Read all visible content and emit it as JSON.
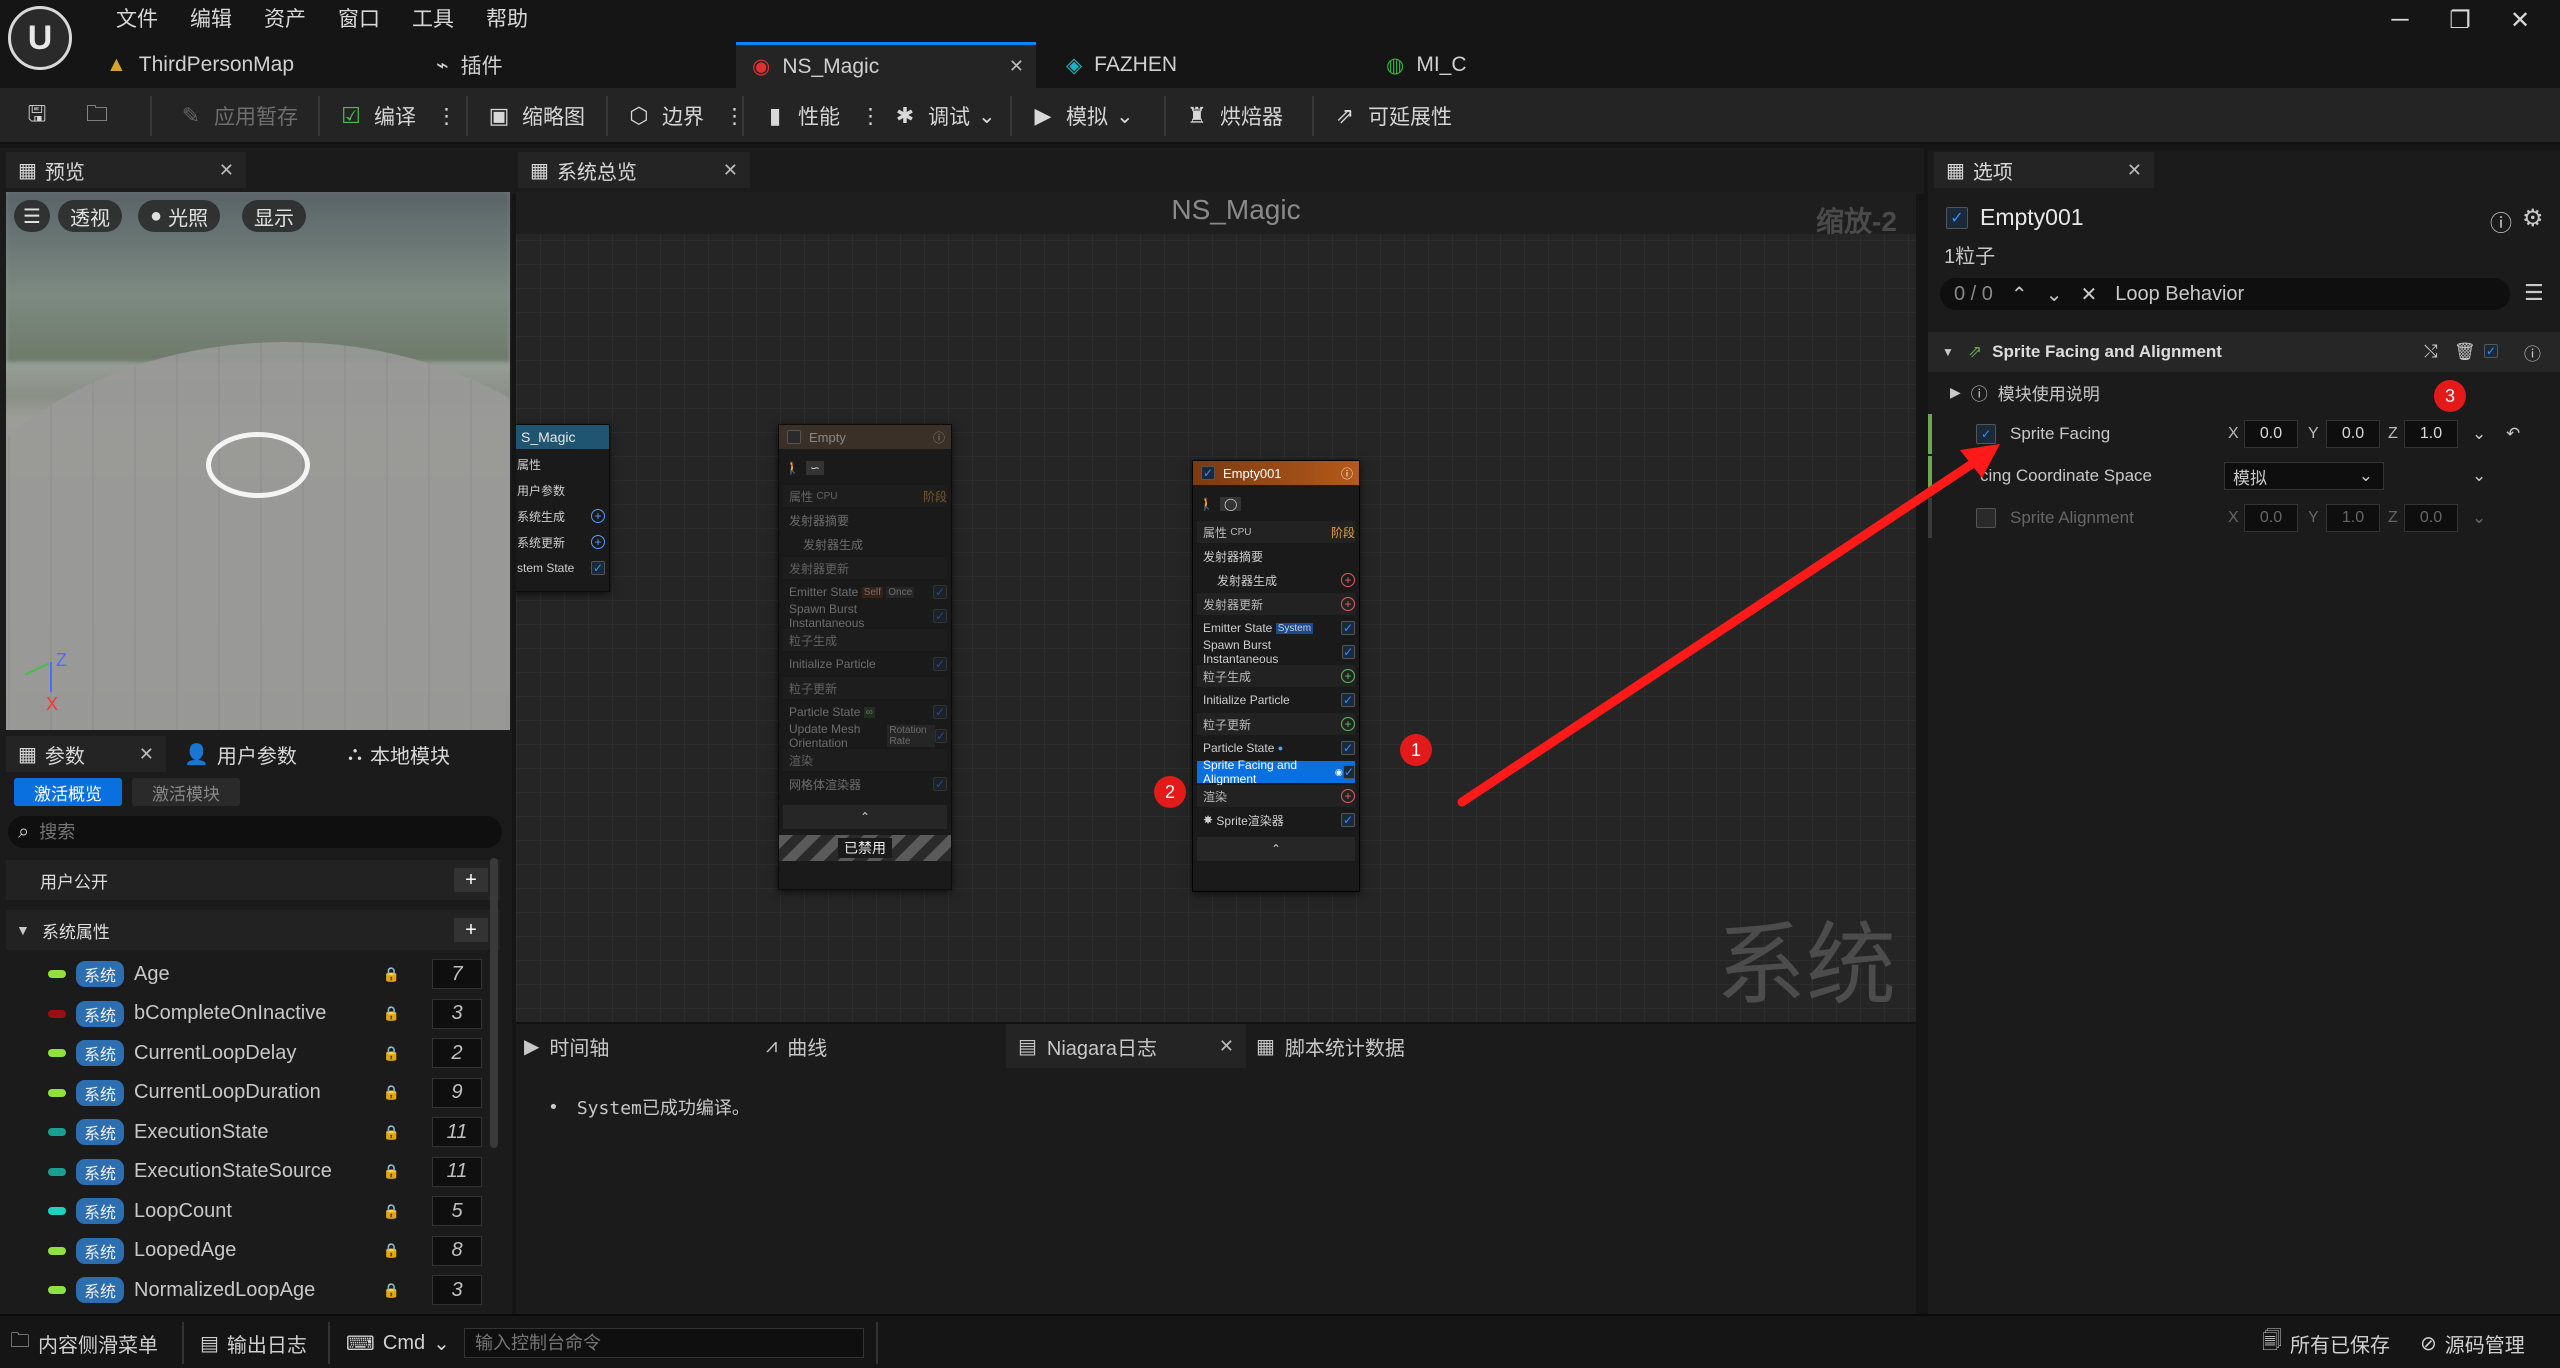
{
  "menu": [
    "文件",
    "编辑",
    "资产",
    "窗口",
    "工具",
    "帮助"
  ],
  "tabs": [
    {
      "label": "ThirdPersonMap",
      "icon": "map-icon"
    },
    {
      "label": "插件",
      "icon": "plug-icon"
    },
    {
      "label": "NS_Magic",
      "icon": "niagara-system-icon",
      "active": true
    },
    {
      "label": "FAZHEN",
      "icon": "emitter-icon"
    },
    {
      "label": "MI_C",
      "icon": "material-instance-icon"
    }
  ],
  "toolbar": {
    "apply": "应用暂存",
    "compile": "编译",
    "thumbnail": "缩略图",
    "bounds": "边界",
    "performance": "性能",
    "debug": "调试",
    "simulate": "模拟",
    "baker": "烘焙器",
    "scalability": "可延展性"
  },
  "preview": {
    "tab": "预览",
    "btn_perspective": "透视",
    "btn_lit": "光照",
    "btn_show": "显示",
    "axis_z": "Z",
    "axis_x": "X"
  },
  "params": {
    "tabs": [
      "参数",
      "用户参数",
      "本地模块"
    ],
    "sub_tabs": [
      "激活概览",
      "激活模块"
    ],
    "search_placeholder": "搜索",
    "user_exposed": "用户公开",
    "system_attrs": "系统属性",
    "badge": "系统",
    "rows": [
      {
        "name": "Age",
        "count": "7",
        "color": "#8fe040"
      },
      {
        "name": "bCompleteOnInactive",
        "count": "3",
        "color": "#9a1010"
      },
      {
        "name": "CurrentLoopDelay",
        "count": "2",
        "color": "#8fe040"
      },
      {
        "name": "CurrentLoopDuration",
        "count": "9",
        "color": "#8fe040"
      },
      {
        "name": "ExecutionState",
        "count": "11",
        "color": "#1aa090"
      },
      {
        "name": "ExecutionStateSource",
        "count": "11",
        "color": "#1aa090"
      },
      {
        "name": "LoopCount",
        "count": "5",
        "color": "#20d0c0"
      },
      {
        "name": "LoopedAge",
        "count": "8",
        "color": "#8fe040"
      },
      {
        "name": "NormalizedLoopAge",
        "count": "3",
        "color": "#8fe040"
      }
    ]
  },
  "overview": {
    "tab": "系统总览",
    "title": "NS_Magic",
    "zoom": "缩放-2",
    "watermark": "系统",
    "system_node": {
      "title": "S_Magic",
      "rows": [
        "属性",
        "用户参数",
        "系统生成",
        "系统更新",
        "stem State"
      ]
    },
    "empty_node": {
      "title": "Empty",
      "attr": "属性",
      "cpu": "CPU",
      "stage": "阶段",
      "rows": [
        "发射器摘要",
        "发射器生成",
        "发射器更新",
        "Emitter State",
        "Spawn Burst Instantaneous",
        "粒子生成",
        "Initialize Particle",
        "粒子更新",
        "Particle State",
        "Update Mesh Orientation",
        "渲染",
        "网格体渲染器"
      ],
      "tag_self": "Self",
      "tag_once": "Once",
      "tag_rotation": "Rotation Rate",
      "tag_dd": "∞",
      "disabled": "已禁用"
    },
    "empty001_node": {
      "title": "Empty001",
      "attr": "属性",
      "cpu": "CPU",
      "stage": "阶段",
      "rows": [
        "发射器摘要",
        "发射器生成",
        "发射器更新",
        "Emitter State",
        "Spawn Burst Instantaneous",
        "粒子生成",
        "Initialize Particle",
        "粒子更新",
        "Particle State",
        "Sprite Facing and Alignment",
        "渲染",
        "Sprite渲染器"
      ],
      "tag_system": "System"
    }
  },
  "log": {
    "tabs": [
      "时间轴",
      "曲线",
      "Niagara日志",
      "脚本统计数据"
    ],
    "message": "System已成功编译。"
  },
  "options": {
    "tab": "选项",
    "emitter": "Empty001",
    "particle_count": "1粒子",
    "search_count": "0 / 0",
    "search_value": "Loop Behavior",
    "module": "Sprite Facing and Alignment",
    "usage": "模块使用说明",
    "sprite_facing": {
      "label": "Sprite Facing",
      "x": "0.0",
      "y": "0.0",
      "z": "1.0"
    },
    "coord_space": {
      "label": "cing Coordinate Space",
      "value": "模拟"
    },
    "sprite_alignment": {
      "label": "Sprite Alignment",
      "x": "0.0",
      "y": "1.0",
      "z": "0.0"
    },
    "axis_x": "X",
    "axis_y": "Y",
    "axis_z": "Z"
  },
  "annotations": {
    "n1": "1",
    "n2": "2",
    "n3": "3"
  },
  "status": {
    "content_drawer": "内容侧滑菜单",
    "output_log": "输出日志",
    "cmd": "Cmd",
    "cmd_placeholder": "输入控制台命令",
    "all_saved": "所有已保存",
    "source_control": "源码管理"
  },
  "colors": {
    "accent": "#0a84ff",
    "arrow": "#ff1a1a",
    "emitter_header": "#b55a1a"
  }
}
